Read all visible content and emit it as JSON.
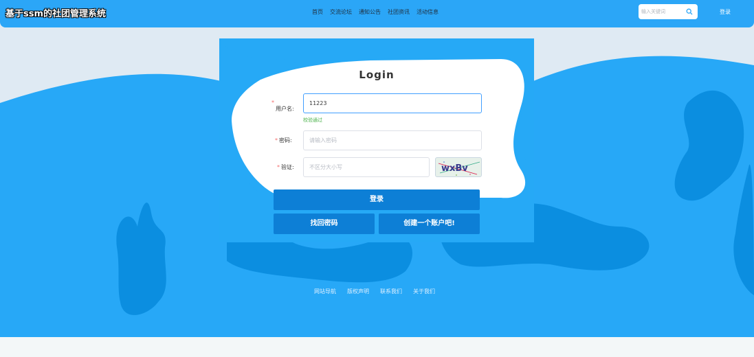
{
  "header": {
    "site_title": "基于ssm的社团管理系统",
    "nav": [
      "首页",
      "交流论坛",
      "通知公告",
      "社团资讯",
      "活动信息"
    ],
    "search": {
      "placeholder": "输入关键词"
    },
    "login_link": "登录"
  },
  "login": {
    "title": "Login",
    "username": {
      "label": "用户名:",
      "value": "11223",
      "validation": "校验通过"
    },
    "password": {
      "label": "密码:",
      "placeholder": "请输入密码"
    },
    "captcha": {
      "label": "验证:",
      "placeholder": "不区分大小写",
      "image_text": "wxBv"
    },
    "required_mark": "*",
    "login_button": "登录",
    "forgot_button": "找回密码",
    "register_button": "创建一个账户吧!"
  },
  "footer": {
    "links": [
      "网站导航",
      "版权声明",
      "联系我们",
      "关于我们"
    ]
  },
  "colors": {
    "primary": "#2ba6f7",
    "button": "#0d7fd6",
    "wave_dark": "#0b8ee0"
  }
}
